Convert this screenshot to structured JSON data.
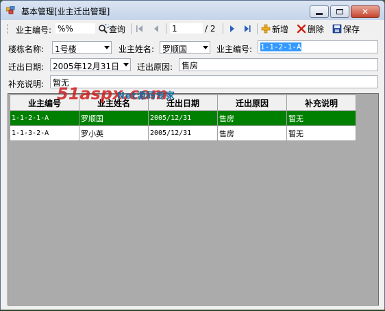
{
  "window": {
    "title": "基本管理[业主迁出管理]"
  },
  "toolbar": {
    "owner_no_label": "业主编号:",
    "owner_no_value": "%%",
    "query_label": "查询",
    "page_current": "1",
    "page_total": "/ 2",
    "add_label": "新增",
    "delete_label": "删除",
    "save_label": "保存"
  },
  "form": {
    "building_label": "楼栋名称:",
    "building_value": "1号楼",
    "owner_name_label": "业主姓名:",
    "owner_name_value": "罗顺国",
    "owner_no_label": "业主编号:",
    "owner_no_value": "1-1-2-1-A",
    "move_date_label": "迁出日期:",
    "move_date_value": "2005年12月31日",
    "reason_label": "迁出原因:",
    "reason_value": "售房",
    "note_label": "补充说明:",
    "note_value": "暂无"
  },
  "grid": {
    "columns": [
      "业主编号",
      "业主姓名",
      "迁出日期",
      "迁出原因",
      "补充说明"
    ],
    "rows": [
      [
        "1-1-2-1-A",
        "罗顺国",
        "2005/12/31",
        "售房",
        "暂无"
      ],
      [
        "1-1-3-2-A",
        "罗小英",
        "2005/12/31",
        "售房",
        "暂无"
      ]
    ]
  },
  "watermark": {
    "logo": "51aspx.com",
    "sub": "Net源码专家"
  },
  "colors": {
    "selected_row": "#008000",
    "selection": "#3399ff",
    "close_button": "#c5452f"
  },
  "icons": [
    "app-icon",
    "search-icon",
    "first-page-icon",
    "prev-page-icon",
    "next-page-icon",
    "last-page-icon",
    "add-icon",
    "delete-icon",
    "save-icon"
  ]
}
